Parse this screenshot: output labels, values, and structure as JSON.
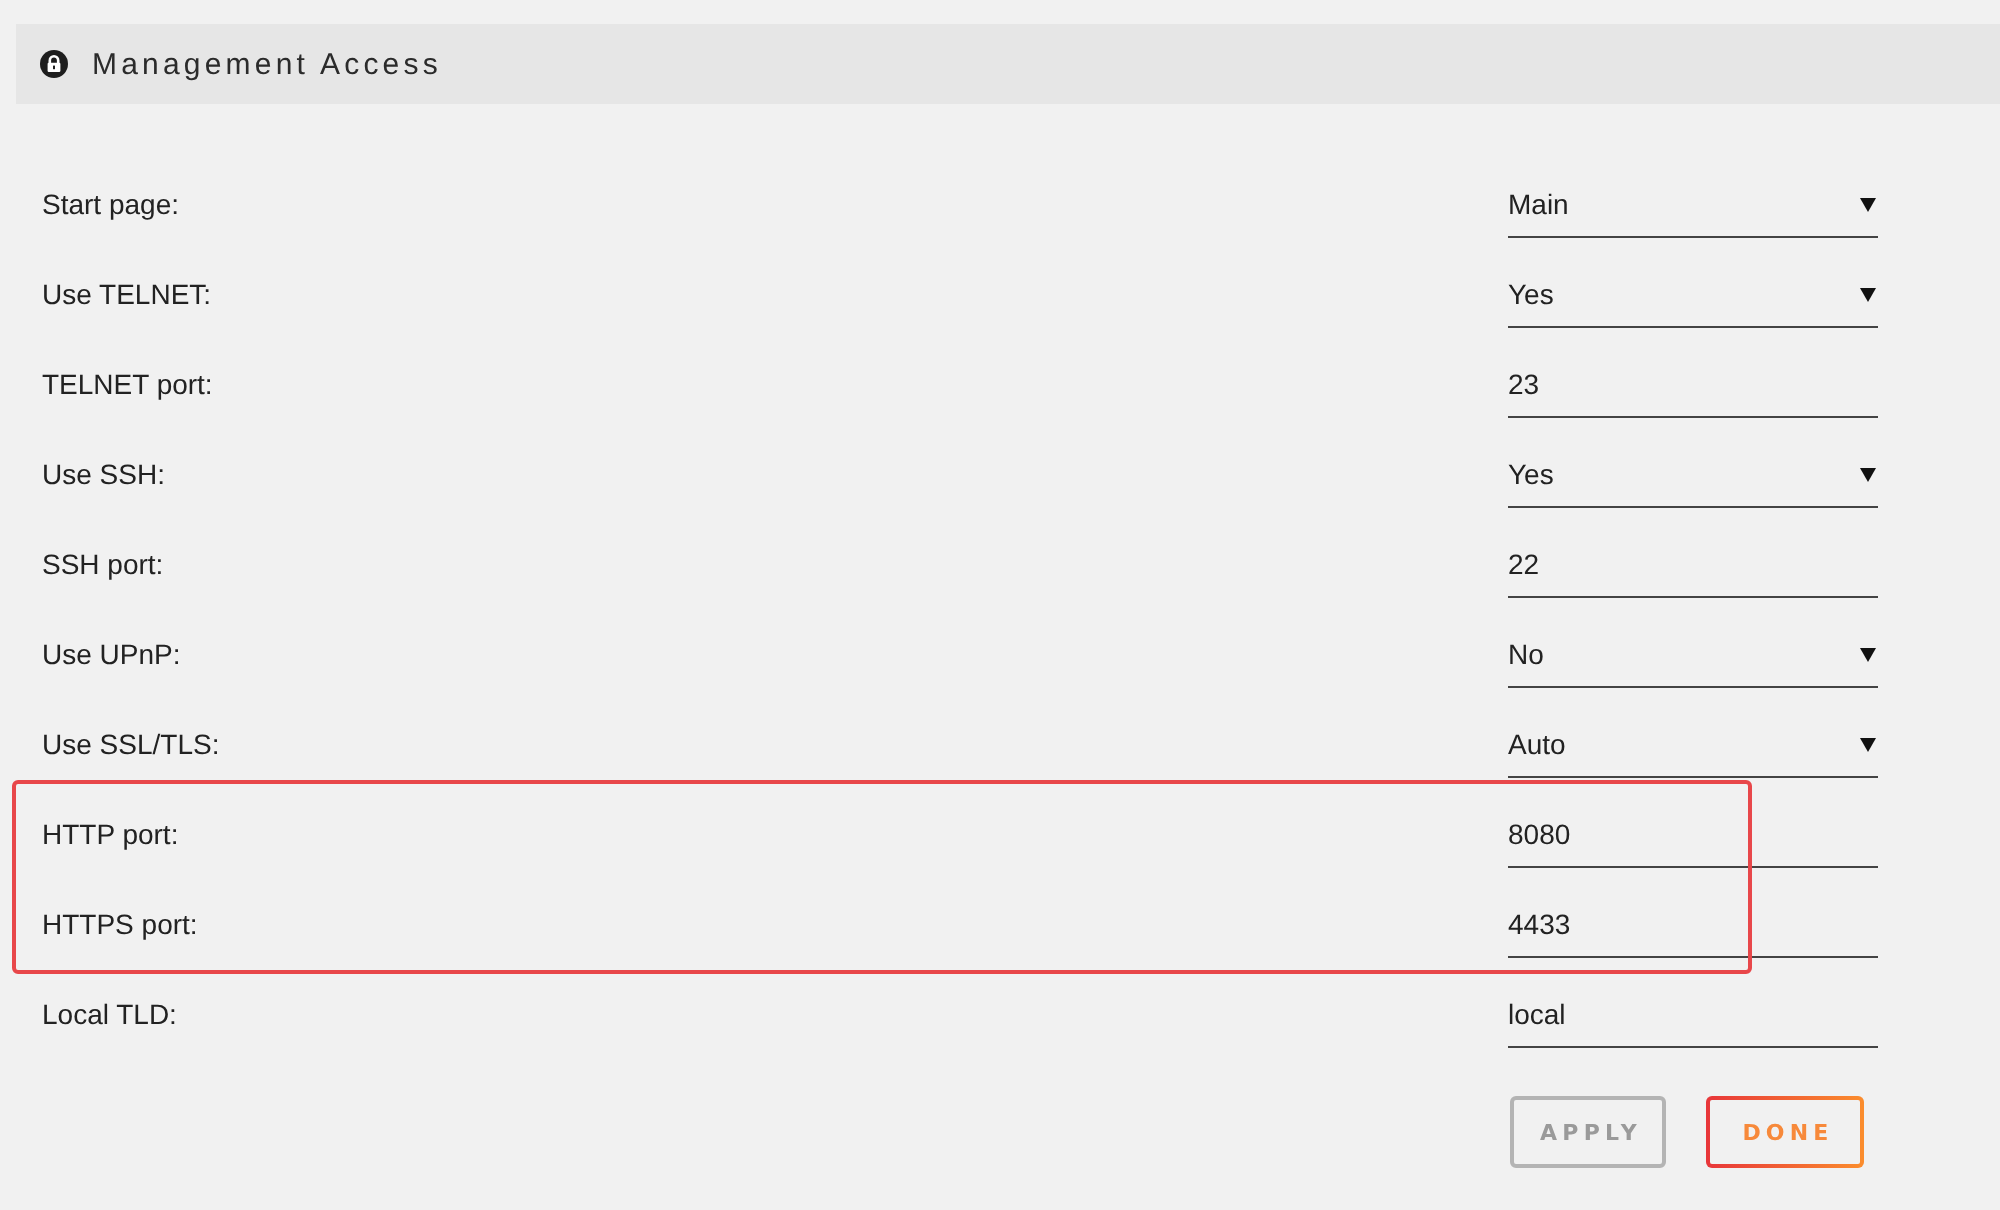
{
  "section": {
    "title": "Management Access"
  },
  "settings": [
    {
      "label": "Start page:",
      "kind": "select",
      "value": "Main",
      "highlighted": false
    },
    {
      "label": "Use TELNET:",
      "kind": "select",
      "value": "Yes",
      "highlighted": false
    },
    {
      "label": "TELNET port:",
      "kind": "text",
      "value": "23",
      "highlighted": false
    },
    {
      "label": "Use SSH:",
      "kind": "select",
      "value": "Yes",
      "highlighted": false
    },
    {
      "label": "SSH port:",
      "kind": "text",
      "value": "22",
      "highlighted": false
    },
    {
      "label": "Use UPnP:",
      "kind": "select",
      "value": "No",
      "highlighted": false
    },
    {
      "label": "Use SSL/TLS:",
      "kind": "select",
      "value": "Auto",
      "highlighted": false
    },
    {
      "label": "HTTP port:",
      "kind": "text",
      "value": "8080",
      "highlighted": true
    },
    {
      "label": "HTTPS port:",
      "kind": "text",
      "value": "4433",
      "highlighted": true
    },
    {
      "label": "Local TLD:",
      "kind": "text",
      "value": "local",
      "highlighted": false
    }
  ],
  "buttons": [
    {
      "label": "APPLY",
      "disabled": true
    },
    {
      "label": "DONE",
      "disabled": false
    }
  ]
}
